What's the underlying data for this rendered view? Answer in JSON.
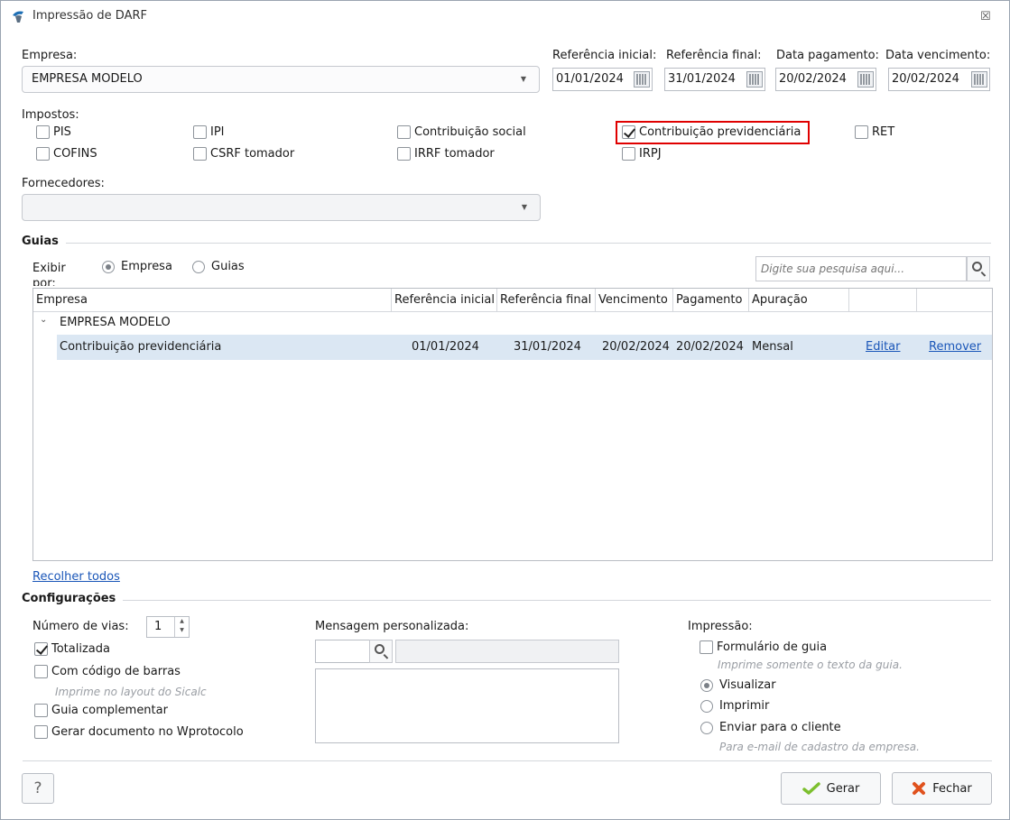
{
  "window": {
    "title": "Impressão de DARF",
    "close_glyph": "☒"
  },
  "empresa": {
    "label": "Empresa:",
    "value": "EMPRESA MODELO"
  },
  "dates": [
    {
      "label": "Referência inicial:",
      "value": "01/01/2024"
    },
    {
      "label": "Referência final:",
      "value": "31/01/2024"
    },
    {
      "label": "Data pagamento:",
      "value": "20/02/2024"
    },
    {
      "label": "Data vencimento:",
      "value": "20/02/2024"
    }
  ],
  "impostos": {
    "label": "Impostos:",
    "items": [
      {
        "label": "PIS",
        "checked": false
      },
      {
        "label": "IPI",
        "checked": false
      },
      {
        "label": "Contribuição social",
        "checked": false
      },
      {
        "label": "Contribuição previdenciária",
        "checked": true
      },
      {
        "label": "RET",
        "checked": false
      },
      {
        "label": "COFINS",
        "checked": false
      },
      {
        "label": "CSRF tomador",
        "checked": false
      },
      {
        "label": "IRRF tomador",
        "checked": false
      },
      {
        "label": "IRPJ",
        "checked": false
      }
    ]
  },
  "fornecedores": {
    "label": "Fornecedores:",
    "value": ""
  },
  "guias": {
    "title": "Guias",
    "exibir_label": "Exibir por:",
    "radio_empresa": "Empresa",
    "radio_guias": "Guias",
    "search_placeholder": "Digite sua pesquisa aqui...",
    "columns": [
      "Empresa",
      "Referência inicial",
      "Referência final",
      "Vencimento",
      "Pagamento",
      "Apuração"
    ],
    "group_name": "EMPRESA MODELO",
    "rows": [
      {
        "empresa": "Contribuição previdenciária",
        "ref_inicial": "01/01/2024",
        "ref_final": "31/01/2024",
        "vencimento": "20/02/2024",
        "pagamento": "20/02/2024",
        "apuracao": "Mensal",
        "edit": "Editar",
        "remove": "Remover"
      }
    ],
    "collapse_link": "Recolher todos"
  },
  "config": {
    "title": "Configurações",
    "num_vias_label": "Número de vias:",
    "num_vias_value": "1",
    "totalizada": "Totalizada",
    "codigo_barras": "Com código de barras",
    "codigo_barras_hint": "Imprime no layout do Sicalc",
    "guia_complementar": "Guia complementar",
    "gerar_wprotocolo": "Gerar documento no Wprotocolo",
    "mensagem_label": "Mensagem personalizada:",
    "impressao_label": "Impressão:",
    "formulario_guia": "Formulário de guia",
    "formulario_hint": "Imprime somente o texto da guia.",
    "visualizar": "Visualizar",
    "imprimir": "Imprimir",
    "enviar_cliente": "Enviar para o cliente",
    "enviar_hint": "Para e-mail de cadastro da empresa."
  },
  "footer": {
    "help": "?",
    "gerar": "Gerar",
    "fechar": "Fechar"
  },
  "colors": {
    "accent": "#1a56b8",
    "highlight": "#e00000",
    "selected_row": "#dbe7f3"
  }
}
